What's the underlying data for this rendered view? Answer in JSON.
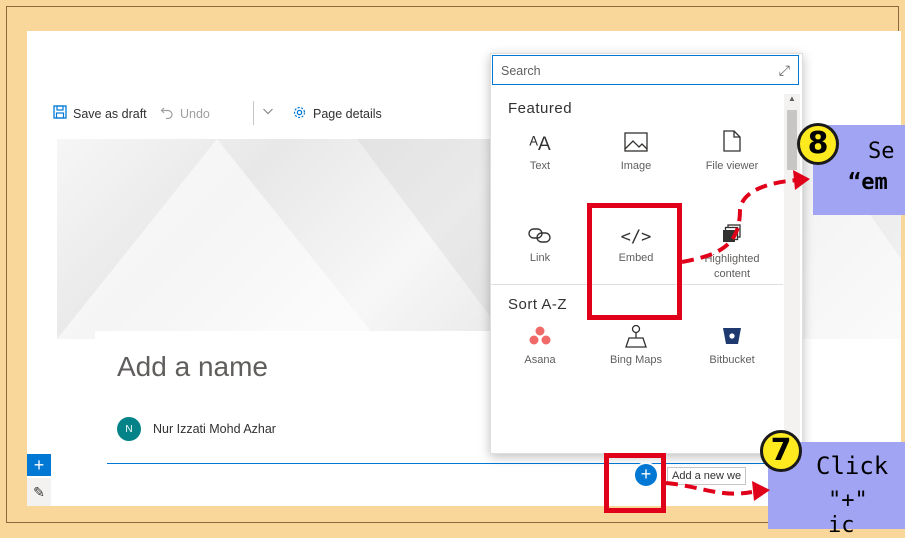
{
  "toolbar": {
    "save_label": "Save as draft",
    "undo_label": "Undo",
    "details_label": "Page details"
  },
  "page": {
    "name_placeholder": "Add a name",
    "author_initial": "N",
    "author_name": "Nur Izzati Mohd Azhar",
    "add_webpart_tooltip": "Add a new we"
  },
  "panel": {
    "search_placeholder": "Search",
    "featured_heading": "Featured",
    "sort_heading": "Sort A-Z",
    "featured": [
      {
        "label": "Text",
        "icon": "text-icon"
      },
      {
        "label": "Image",
        "icon": "image-icon"
      },
      {
        "label": "File viewer",
        "icon": "file-viewer-icon"
      },
      {
        "label": "Link",
        "icon": "link-icon"
      },
      {
        "label": "Embed",
        "icon": "embed-icon"
      },
      {
        "label": "Highlighted content",
        "icon": "highlighted-content-icon"
      }
    ],
    "sorted": [
      {
        "label": "Asana",
        "icon": "asana-icon"
      },
      {
        "label": "Bing Maps",
        "icon": "bing-maps-icon"
      },
      {
        "label": "Bitbucket",
        "icon": "bitbucket-icon"
      }
    ]
  },
  "callouts": {
    "step8_number": "8",
    "step8_line1": "Se",
    "step8_line2": "“em",
    "step7_number": "7",
    "step7_line1": "Click",
    "step7_line2": "\"+\" ic"
  },
  "colors": {
    "accent": "#0078d4",
    "highlight": "#e0001a",
    "callout_bg": "#a0a4f3",
    "badge": "#ffea1f",
    "page_bg": "#f9d79a"
  }
}
